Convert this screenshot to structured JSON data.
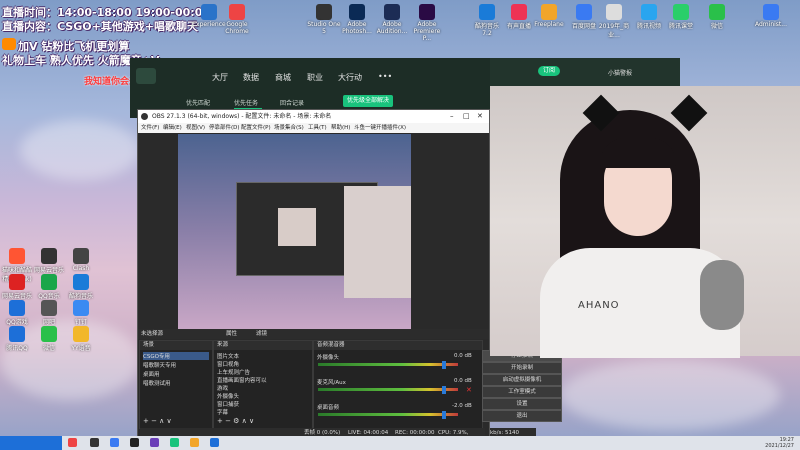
{
  "overlay": {
    "line1": "直播时间：14:00-18:00 19:00-00:00",
    "line2": "直播内容：CSGO+其他游戏+唱歌聊天",
    "line3": "加V 钻粉比飞机更划算",
    "line4": "礼物上车 熟人优先 火箭魔音+V",
    "scroll": "我知道你会来着我向前走"
  },
  "desktop_icons": [
    {
      "label": "Experience",
      "color": "#2a73c9"
    },
    {
      "label": "Google Chrome",
      "color": "#e44"
    },
    {
      "label": "Studio One 5",
      "color": "#333"
    },
    {
      "label": "Adobe Photosh...",
      "color": "#0b2a55"
    },
    {
      "label": "Adobe Audition...",
      "color": "#1c2c55"
    },
    {
      "label": "Adobe Premiere P...",
      "color": "#2a0a44"
    },
    {
      "label": "酷狗音乐 7.2",
      "color": "#1a7bd8"
    },
    {
      "label": "有声直播",
      "color": "#e35"
    },
    {
      "label": "Freeplane",
      "color": "#f2a52a"
    },
    {
      "label": "百度网盘",
      "color": "#3a7af2"
    },
    {
      "label": "2019年_商业...",
      "color": "#ddd"
    },
    {
      "label": "腾讯视频",
      "color": "#2aa5ef"
    },
    {
      "label": "腾讯课堂",
      "color": "#2acf6a"
    },
    {
      "label": "微信",
      "color": "#2ac04a"
    },
    {
      "label": "Administ...",
      "color": "#3a7af2"
    }
  ],
  "left_icons": [
    {
      "label": "猫咪和酷酷精选(pink)",
      "color": "#f53"
    },
    {
      "label": "网易云音乐",
      "color": "#333"
    },
    {
      "label": "Clash",
      "color": "#444"
    },
    {
      "label": "网易云音乐",
      "color": "#d22"
    },
    {
      "label": "QQ音乐",
      "color": "#1aa64a"
    },
    {
      "label": "酷狗音乐",
      "color": "#1a7bd8"
    },
    {
      "label": "QQ游戏",
      "color": "#1d6fd8"
    },
    {
      "label": "网吧",
      "color": "#555"
    },
    {
      "label": "钉钉",
      "color": "#3a8af2"
    },
    {
      "label": "腾讯QQ",
      "color": "#1d6fd8"
    },
    {
      "label": "微信",
      "color": "#2ac04a"
    },
    {
      "label": "YY语音",
      "color": "#f2b72a"
    }
  ],
  "live_app": {
    "nav": [
      "大厅",
      "数据",
      "商城",
      "职业",
      "大行动"
    ],
    "more": "•••",
    "sub": [
      "优先匹配",
      "优先任务",
      "回合记录",
      "优先级明细"
    ],
    "pill": "优先级全部解决",
    "right_btn": "订阅",
    "right_name": "小猫警报"
  },
  "obs": {
    "title": "OBS 27.1.3 (64-bit, windows) - 配置文件: 未命名 - 场景: 未命名",
    "menu": [
      "文件(F)",
      "编辑(E)",
      "视图(V)",
      "停靠部件(D)",
      "配置文件(P)",
      "场景集合(S)",
      "工具(T)",
      "帮助(H)",
      "斗鱼一键开播插件(X)"
    ],
    "bottom_tabs": [
      "未选择源",
      "属性",
      "滤镜"
    ],
    "scenes_header": "场景",
    "scenes": [
      "CSGO专用",
      "唱歌聊天专用",
      "桌面用",
      "唱歌测试用"
    ],
    "sources_header": "来源",
    "sources": [
      "图片文本",
      "窗口视角",
      "上车规则广告",
      "直播画面窗内容可以",
      "游戏",
      "外摄像头",
      "窗口捕获",
      "字幕"
    ],
    "mixer_header": "音频混音器",
    "mixer": [
      {
        "name": "外摄像头",
        "db": "0.0 dB"
      },
      {
        "name": "麦克风/Aux",
        "db": "0.0 dB"
      },
      {
        "name": "桌面音频",
        "db": "-2.0 dB"
      }
    ],
    "controls": [
      "停止推流",
      "开始录制",
      "启动虚拟摄像机",
      "工作室模式",
      "设置",
      "退出"
    ],
    "status": {
      "dropped": "丢帧 0 (0.0%)",
      "live": "LIVE: 04:00:04",
      "rec": "REC: 00:00:00",
      "cpu": "CPU: 7.9%, 60.00 fps",
      "kbps": "kb/s: 5140"
    }
  },
  "webcam": {
    "shirt_text": "AHANO"
  },
  "taskbar": {
    "time": "19:27",
    "date": "2021/12/27"
  },
  "colors": {
    "obs_bg": "#2a2a2a",
    "accent_green": "#19c37d",
    "overlay_red": "#ff3a3a",
    "taskbar": "#dfe3ea"
  }
}
